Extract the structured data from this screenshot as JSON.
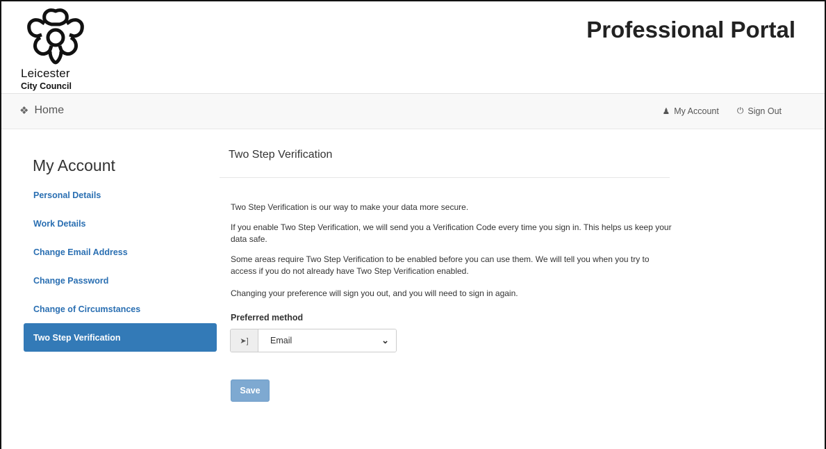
{
  "header": {
    "logo_line1": "Leicester",
    "logo_line2": "City Council",
    "portal_title": "Professional Portal"
  },
  "navbar": {
    "home_icon": "home-icon",
    "home_label": "Home",
    "my_account_icon": "user-icon",
    "my_account_label": "My Account",
    "sign_out_icon": "power-icon",
    "sign_out_label": "Sign Out"
  },
  "sidebar": {
    "title": "My Account",
    "items": [
      {
        "label": "Personal Details",
        "active": false
      },
      {
        "label": "Work Details",
        "active": false
      },
      {
        "label": "Change Email Address",
        "active": false
      },
      {
        "label": "Change Password",
        "active": false
      },
      {
        "label": "Change of Circumstances",
        "active": false
      },
      {
        "label": "Two Step Verification",
        "active": true
      }
    ],
    "active_color": "#337ab7",
    "link_color": "#2a6fb2"
  },
  "main": {
    "title": "Two Step Verification",
    "paragraphs": [
      "Two Step Verification is our way to make your data more secure.",
      "If you enable Two Step Verification, we will send you a Verification Code every time you sign in. This helps us keep your data safe.",
      "Some areas require Two Step Verification to be enabled before you can use them. We will tell you when you try to access if you do not already have Two Step Verification enabled.",
      "Changing your preference will sign you out, and you will need to sign in again."
    ],
    "preferred_label": "Preferred method",
    "select_icon": "sign-in-icon",
    "select_value": "Email",
    "save_label": "Save"
  }
}
